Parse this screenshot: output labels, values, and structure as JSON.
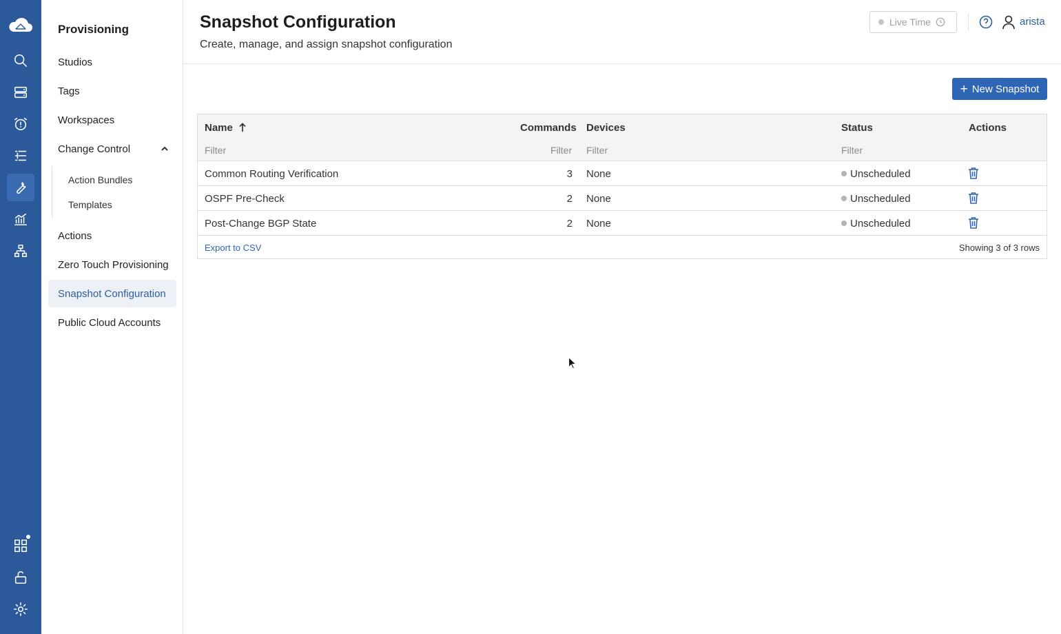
{
  "rail": {
    "icons": [
      "cloud-logo-icon",
      "search-icon",
      "devices-icon",
      "alarm-icon",
      "list-icon",
      "wrench-icon",
      "analytics-icon",
      "topology-icon",
      "apps-icon",
      "unlock-icon",
      "gear-icon"
    ],
    "active": "wrench-icon",
    "color": "#2b5999"
  },
  "subnav": {
    "title": "Provisioning",
    "items": {
      "studios": "Studios",
      "tags": "Tags",
      "workspaces": "Workspaces",
      "change_control": "Change Control",
      "action_bundles": "Action Bundles",
      "templates": "Templates",
      "actions": "Actions",
      "ztp": "Zero Touch Provisioning",
      "snapshot_configuration": "Snapshot Configuration",
      "public_cloud_accounts": "Public Cloud Accounts"
    },
    "active": "Snapshot Configuration"
  },
  "header": {
    "title": "Snapshot Configuration",
    "subtitle": "Create, manage, and assign snapshot configuration",
    "live_time": "Live Time",
    "user": "arista"
  },
  "toolbar": {
    "new_snapshot_label": "New Snapshot"
  },
  "table": {
    "columns": {
      "name": "Name",
      "commands": "Commands",
      "devices": "Devices",
      "status": "Status",
      "actions": "Actions"
    },
    "filter_placeholder": "Filter",
    "rows": [
      {
        "name": "Common Routing Verification",
        "commands": "3",
        "devices": "None",
        "status": "Unscheduled"
      },
      {
        "name": "OSPF Pre-Check",
        "commands": "2",
        "devices": "None",
        "status": "Unscheduled"
      },
      {
        "name": "Post-Change BGP State",
        "commands": "2",
        "devices": "None",
        "status": "Unscheduled"
      }
    ],
    "export_label": "Export to CSV",
    "row_count": "Showing 3 of 3 rows"
  },
  "colors": {
    "accent": "#2f65b5",
    "active_nav_bg": "#edf0f5"
  }
}
